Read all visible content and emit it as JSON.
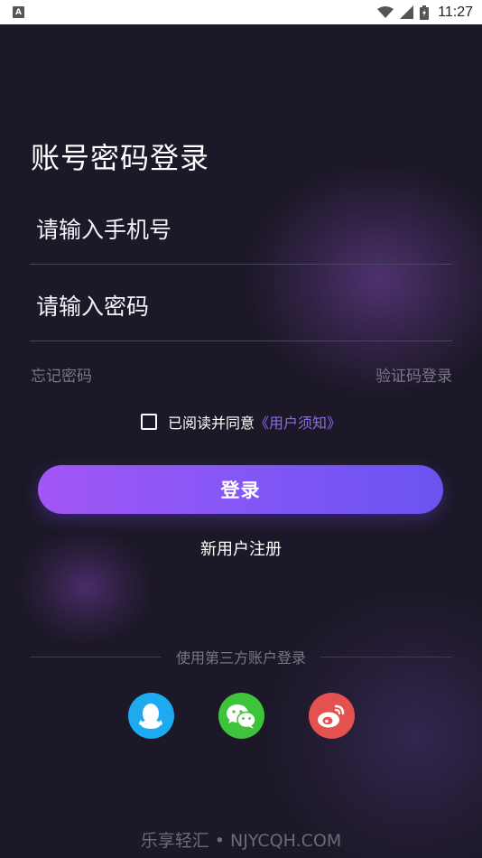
{
  "status_bar": {
    "app_icon_letter": "A",
    "time": "11:27"
  },
  "login": {
    "title": "账号密码登录",
    "phone_placeholder": "请输入手机号",
    "password_placeholder": "请输入密码",
    "forgot_password": "忘记密码",
    "sms_login": "验证码登录",
    "agreement_text": "已阅读并同意",
    "agreement_link": "《用户须知》",
    "login_button": "登录",
    "register_link": "新用户注册",
    "third_party_label": "使用第三方账户登录"
  },
  "social": [
    {
      "name": "qq",
      "icon": "qq-icon",
      "color": "#1eaaf1"
    },
    {
      "name": "wechat",
      "icon": "wechat-icon",
      "color": "#3ec43a"
    },
    {
      "name": "weibo",
      "icon": "weibo-icon",
      "color": "#e4514f"
    }
  ],
  "watermark": "乐享轻汇 • NJYCQH.COM",
  "colors": {
    "background": "#1c1827",
    "accent": "#8a6cf0",
    "button_gradient_start": "#a256f4",
    "button_gradient_end": "#6b53f0"
  }
}
